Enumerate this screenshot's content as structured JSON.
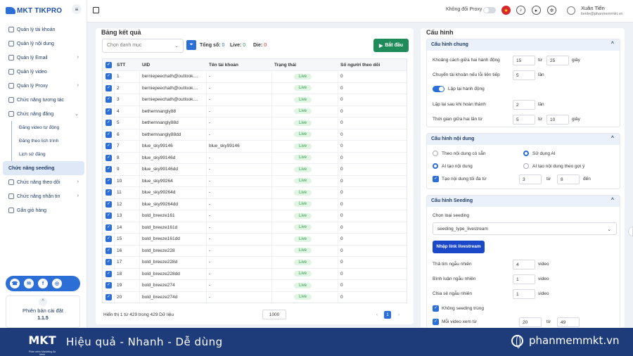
{
  "brand": {
    "name": "MKT TIKPRO"
  },
  "sidebar": {
    "items": [
      {
        "label": "Quản lý tài khoản",
        "chevron": ""
      },
      {
        "label": "Quản lý nội dung",
        "chevron": ""
      },
      {
        "label": "Quản lý Email",
        "chevron": "›"
      },
      {
        "label": "Quản lý video",
        "chevron": ""
      },
      {
        "label": "Quản lý Proxy",
        "chevron": "›"
      },
      {
        "label": "Chức năng tương tác",
        "chevron": ""
      },
      {
        "label": "Chức năng đăng",
        "chevron": "⌄"
      }
    ],
    "subitems": [
      "Đăng video tự động",
      "Đăng theo lịch trình",
      "Lịch sử đăng"
    ],
    "items_after": [
      {
        "label": "Chức năng seeding",
        "chevron": ""
      },
      {
        "label": "Chức năng theo dõi",
        "chevron": "›"
      },
      {
        "label": "Chức năng nhắn tin",
        "chevron": "›"
      },
      {
        "label": "Gắn giỏ hàng",
        "chevron": ""
      }
    ],
    "version_label": "Phiên bản cài đặt",
    "version": "1.1.5"
  },
  "header": {
    "proxy_label": "Không đổi Proxy",
    "user_name": "Xuân Tiến",
    "user_email": "tienle@phanmemmkt.vn"
  },
  "results": {
    "title": "Bảng kết quả",
    "select_placeholder": "Chọn danh mục",
    "total_label": "Tổng số:",
    "total_value": "0",
    "live_label": "Live:",
    "live_value": "0",
    "die_label": "Die:",
    "die_value": "0",
    "start_label": "Bắt đầu",
    "columns": [
      "STT",
      "UID",
      "Tên tài khoản",
      "Trạng thái",
      "Số người theo dõi"
    ],
    "rows": [
      {
        "stt": "1",
        "uid": "berniepeechath@outlook....",
        "acc": "-",
        "status": "Live",
        "fol": "0"
      },
      {
        "stt": "2",
        "uid": "berniepeechath@outlook....",
        "acc": "-",
        "status": "Live",
        "fol": "0"
      },
      {
        "stt": "3",
        "uid": "berniepeechath@outlook....",
        "acc": "-",
        "status": "Live",
        "fol": "0"
      },
      {
        "stt": "4",
        "uid": "bethemnangly88",
        "acc": "-",
        "status": "Live",
        "fol": "0"
      },
      {
        "stt": "5",
        "uid": "bethemnangly88d",
        "acc": "-",
        "status": "Live",
        "fol": "0"
      },
      {
        "stt": "6",
        "uid": "bethemnangly88dd",
        "acc": "-",
        "status": "Live",
        "fol": "0"
      },
      {
        "stt": "7",
        "uid": "blue_sky99146",
        "acc": "blue_sky99146",
        "status": "Live",
        "fol": "0"
      },
      {
        "stt": "8",
        "uid": "blue_sky99146d",
        "acc": "-",
        "status": "Live",
        "fol": "0"
      },
      {
        "stt": "9",
        "uid": "blue_sky99146dd",
        "acc": "-",
        "status": "Live",
        "fol": "0"
      },
      {
        "stt": "10",
        "uid": "blue_sky99264",
        "acc": "-",
        "status": "Live",
        "fol": "0"
      },
      {
        "stt": "11",
        "uid": "blue_sky99264d",
        "acc": "-",
        "status": "Live",
        "fol": "0"
      },
      {
        "stt": "12",
        "uid": "blue_sky99264dd",
        "acc": "-",
        "status": "Live",
        "fol": "0"
      },
      {
        "stt": "13",
        "uid": "bold_breeze161",
        "acc": "-",
        "status": "Live",
        "fol": "0"
      },
      {
        "stt": "14",
        "uid": "bold_breeze161d",
        "acc": "-",
        "status": "Live",
        "fol": "0"
      },
      {
        "stt": "15",
        "uid": "bold_breeze161dd",
        "acc": "-",
        "status": "Live",
        "fol": "0"
      },
      {
        "stt": "16",
        "uid": "bold_breeze228",
        "acc": "-",
        "status": "Live",
        "fol": "0"
      },
      {
        "stt": "17",
        "uid": "bold_breeze228d",
        "acc": "-",
        "status": "Live",
        "fol": "0"
      },
      {
        "stt": "18",
        "uid": "bold_breeze228dd",
        "acc": "-",
        "status": "Live",
        "fol": "0"
      },
      {
        "stt": "19",
        "uid": "bold_breeze274",
        "acc": "-",
        "status": "Live",
        "fol": "0"
      },
      {
        "stt": "20",
        "uid": "bold_breeze274d",
        "acc": "-",
        "status": "Live",
        "fol": "0"
      }
    ],
    "footer_info": "Hiển thị 1 từ 429 trong 429 Dữ liệu",
    "page_size": "1000",
    "page_prev": "‹",
    "page_current": "1",
    "page_next": "›"
  },
  "config": {
    "title": "Cấu hình",
    "general": {
      "title": "Cấu hình chung",
      "delay_label": "Khoảng cách giữa hai hành động",
      "delay_from": "15",
      "delay_to": "25",
      "switch_label": "Chuyển tài khoản nếu lỗi liên tiếp",
      "switch_value": "5",
      "repeat_label": "Lặp lại hành động",
      "repeat_after_label": "Lặp lại sau khi hoàn thành",
      "repeat_after_value": "2",
      "wait_label": "Thời gian giữa hai lần từ",
      "wait_from": "5",
      "wait_to": "10",
      "unit_seconds": "giây",
      "unit_times": "lần",
      "word_from": "từ"
    },
    "content": {
      "title": "Cấu hình nội dung",
      "opt_existing": "Theo nội dung có sẵn",
      "opt_ai": "Sử dụng AI",
      "opt_ai_create": "AI tạo nội dung",
      "opt_ai_suggest": "AI tạo nội dung theo gợi ý",
      "max_label": "Tạo nội dung tối đa từ",
      "max_from": "3",
      "max_to": "8",
      "word_to": "đến"
    },
    "seeding": {
      "title": "Cấu hình Seeding",
      "type_label": "Chọn loại seeding",
      "type_value": "seeding_type_livestream",
      "import_label": "Nhập link livestream",
      "heart_label": "Thả tim ngẫu nhiên",
      "heart_value": "4",
      "comment_label": "Bình luận ngẫu nhiên",
      "comment_value": "1",
      "share_label": "Chia sẻ ngẫu nhiên",
      "share_value": "1",
      "unit_video": "video",
      "no_dup_label": "Không seeding trùng",
      "watch_label": "Mỗi video xem từ",
      "watch_from": "20",
      "watch_to": "49"
    }
  },
  "banner": {
    "logo": "MKT",
    "logo_sub": "Phần mềm Marketing đa kênh",
    "slogan": "Hiệu quả - Nhanh - Dễ dùng",
    "site": "phanmemmkt.vn"
  },
  "colors": {
    "primary": "#2b6fd6",
    "start": "#1e8c5a",
    "banner": "#1f3c7a",
    "live_bg": "#e1f5e4",
    "live_text": "#2e9b45"
  }
}
